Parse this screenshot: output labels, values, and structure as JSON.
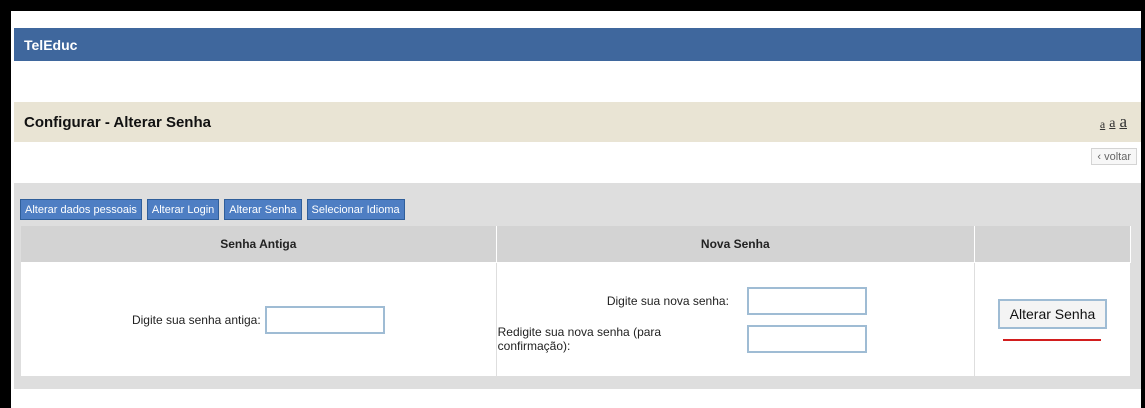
{
  "app": {
    "name": "TelEduc"
  },
  "page": {
    "title": "Configurar - Alterar Senha",
    "font_size_controls": [
      "a",
      "a",
      "a"
    ],
    "back_link": "‹ voltar"
  },
  "tabs": [
    "Alterar dados pessoais",
    "Alterar Login",
    "Alterar Senha",
    "Selecionar Idioma"
  ],
  "table": {
    "headers": [
      "Senha Antiga",
      "Nova Senha",
      ""
    ],
    "old_password_label": "Digite sua senha antiga:",
    "new_password_label": "Digite sua nova senha:",
    "confirm_password_label": "Redigite sua nova senha (para confirmação):",
    "old_password_value": "",
    "new_password_value": "",
    "confirm_password_value": ""
  },
  "actions": {
    "change_password_label": "Alterar Senha"
  },
  "colors": {
    "header_bg": "#3f679d",
    "title_bar_bg": "#e9e4d4",
    "tab_bg": "#4e7ec3",
    "panel_bg": "#dedede",
    "annotation_underline": "#d21e1e"
  }
}
